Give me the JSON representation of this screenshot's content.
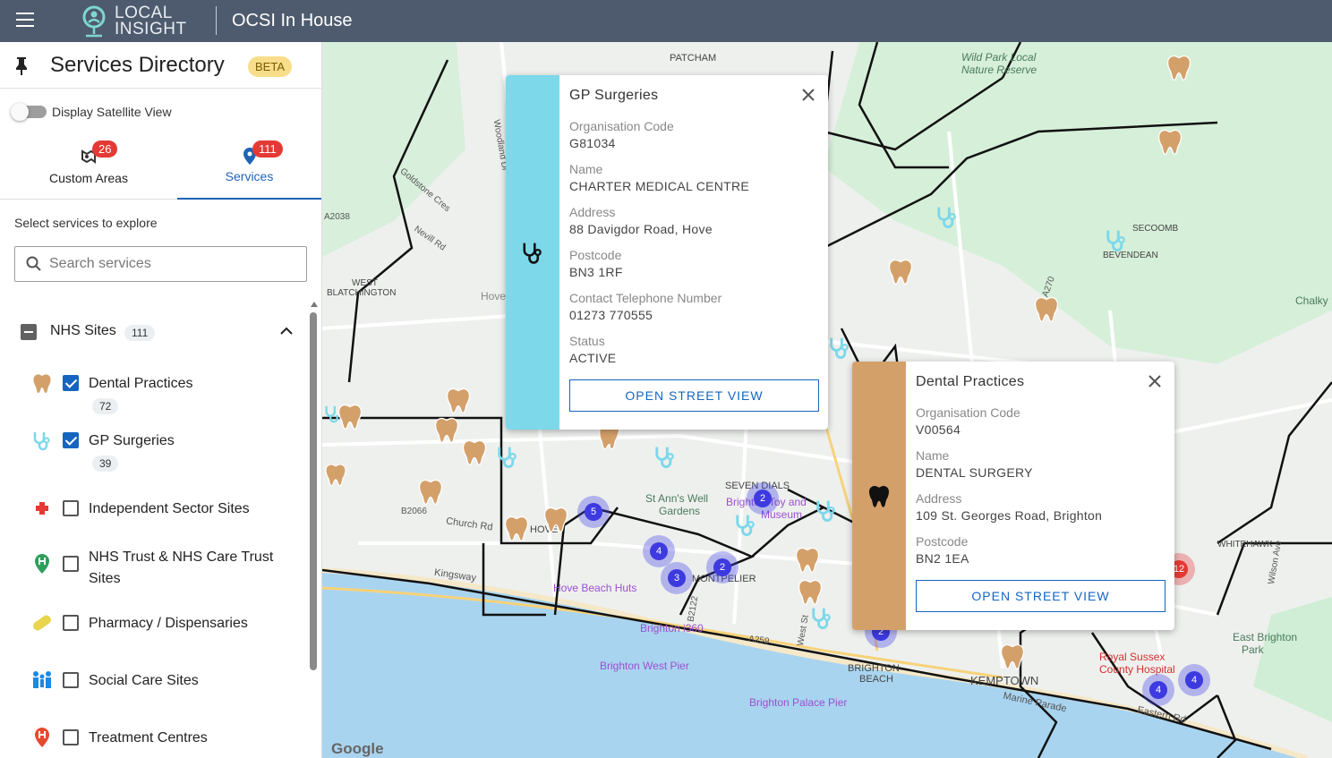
{
  "app": {
    "logo_line1": "LOCAL",
    "logo_line2": "INSIGHT",
    "workspace": "OCSI In House"
  },
  "sidebar": {
    "title": "Services Directory",
    "beta": "BETA",
    "satellite_toggle": {
      "label": "Display Satellite View",
      "on": false
    },
    "tabs": [
      {
        "label": "Custom Areas",
        "badge": "26",
        "active": false
      },
      {
        "label": "Services",
        "badge": "111",
        "active": true
      }
    ],
    "select_label": "Select services to explore",
    "search": {
      "placeholder": "Search services",
      "value": ""
    },
    "group": {
      "label": "NHS Sites",
      "count": "111",
      "expanded": true
    },
    "items": [
      {
        "label": "Dental Practices",
        "count": "72",
        "checked": true,
        "icon": "tooth-icon"
      },
      {
        "label": "GP Surgeries",
        "count": "39",
        "checked": true,
        "icon": "stethoscope-icon"
      },
      {
        "label": "Independent Sector Sites",
        "checked": false,
        "icon": "red-cross-icon"
      },
      {
        "label": "NHS Trust & NHS Care Trust Sites",
        "checked": false,
        "icon": "hospital-pin-icon"
      },
      {
        "label": "Pharmacy / Dispensaries",
        "checked": false,
        "icon": "pill-icon"
      },
      {
        "label": "Social Care Sites",
        "checked": false,
        "icon": "people-icon"
      },
      {
        "label": "Treatment Centres",
        "checked": false,
        "icon": "treatment-pin-icon"
      }
    ]
  },
  "map": {
    "labels": [
      "PATCHAM",
      "Wild Park Local",
      "Nature Reserve",
      "SECOOMB",
      "BEVENDEAN",
      "Chalky",
      "WEST",
      "BLATCHINGTON",
      "Hove",
      "A2038",
      "Nevill Rd",
      "Goldstone Cres",
      "Woodland Dr",
      "SEVEN DIALS",
      "St Ann's Well",
      "Gardens",
      "Brighton Toy and",
      "Museum",
      "B2066",
      "Church Rd",
      "HOVE",
      "Kingsway",
      "MONTPELIER",
      "Hove Beach Huts",
      "B2122",
      "Brighton i360",
      "A259",
      "West St",
      "Brighton West Pier",
      "Brighton Palace Pier",
      "BRIGHTON",
      "BEACH",
      "KEMPTOWN",
      "Marine Parade",
      "Eastern Rd",
      "Royal Sussex",
      "County Hospital",
      "East Brighton",
      "Park",
      "WHITEHAWK",
      "Wilson Ave",
      "A270"
    ],
    "clusters": [
      {
        "n": "5",
        "color": "blue"
      },
      {
        "n": "4",
        "color": "blue"
      },
      {
        "n": "3",
        "color": "blue"
      },
      {
        "n": "2",
        "color": "blue"
      },
      {
        "n": "2",
        "color": "blue"
      },
      {
        "n": "2",
        "color": "blue"
      },
      {
        "n": "4",
        "color": "blue"
      },
      {
        "n": "4",
        "color": "blue"
      },
      {
        "n": "12",
        "color": "red"
      }
    ],
    "attribution": "Google"
  },
  "popups": {
    "gp": {
      "title": "GP Surgeries",
      "bar_color": "#7dd8ea",
      "fields": [
        {
          "label": "Organisation Code",
          "value": "G81034"
        },
        {
          "label": "Name",
          "value": "CHARTER MEDICAL CENTRE"
        },
        {
          "label": "Address",
          "value": "88 Davigdor Road, Hove"
        },
        {
          "label": "Postcode",
          "value": "BN3 1RF"
        },
        {
          "label": "Contact Telephone Number",
          "value": "01273 770555"
        },
        {
          "label": "Status",
          "value": "ACTIVE"
        }
      ],
      "button": "OPEN STREET VIEW"
    },
    "dental": {
      "title": "Dental Practices",
      "bar_color": "#d4a06a",
      "fields": [
        {
          "label": "Organisation Code",
          "value": "V00564"
        },
        {
          "label": "Name",
          "value": "DENTAL SURGERY"
        },
        {
          "label": "Address",
          "value": "109 St. Georges Road, Brighton"
        },
        {
          "label": "Postcode",
          "value": "BN2 1EA"
        }
      ],
      "button": "OPEN STREET VIEW"
    }
  }
}
